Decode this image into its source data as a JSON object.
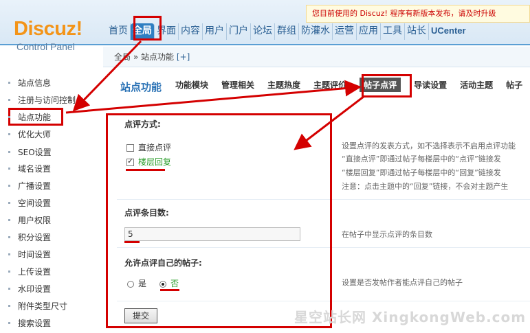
{
  "header": {
    "logo": "Discuz!",
    "logo_sub": "Control Panel",
    "notice": "您目前使用的 Discuz! 程序有新版本发布，请及时升级"
  },
  "topnav": [
    "首页",
    "全局",
    "界面",
    "内容",
    "用户",
    "门户",
    "论坛",
    "群组",
    "防灌水",
    "运营",
    "应用",
    "工具",
    "站长",
    "UCenter"
  ],
  "breadcrumb": {
    "root": "全局",
    "sep": "»",
    "current": "站点功能",
    "add": "[+]"
  },
  "sidebar": [
    "站点信息",
    "注册与访问控制",
    "站点功能",
    "优化大师",
    "SEO设置",
    "域名设置",
    "广播设置",
    "空间设置",
    "用户权限",
    "积分设置",
    "时间设置",
    "上传设置",
    "水印设置",
    "附件类型尺寸",
    "搜索设置"
  ],
  "section_title": "站点功能",
  "subtabs": [
    "功能模块",
    "管理相关",
    "主题热度",
    "主题评价",
    "帖子点评",
    "导读设置",
    "活动主题",
    "帖子"
  ],
  "form": {
    "mode_label": "点评方式:",
    "mode_opt1": "直接点评",
    "mode_opt2": "楼层回复",
    "count_label": "点评条目数:",
    "count_value": "5",
    "self_label": "允许点评自己的帖子:",
    "self_yes": "是",
    "self_no": "否",
    "submit": "提交"
  },
  "descs": {
    "mode_1": "设置点评的发表方式，如不选择表示不启用点评功能",
    "mode_2": "“直接点评”即通过帖子每楼层中的“点评”链接发",
    "mode_3": "“楼层回复”即通过帖子每楼层中的“回复”链接发",
    "mode_4": "注意：点击主题中的“回复”链接，不会对主题产生",
    "count": "在帖子中显示点评的条目数",
    "self": "设置是否发帖作者能点评自己的帖子"
  },
  "watermark": "星空站长网 XingkongWeb.com",
  "colors": {
    "accent": "#d40000",
    "brand": "#2f7fc2"
  }
}
